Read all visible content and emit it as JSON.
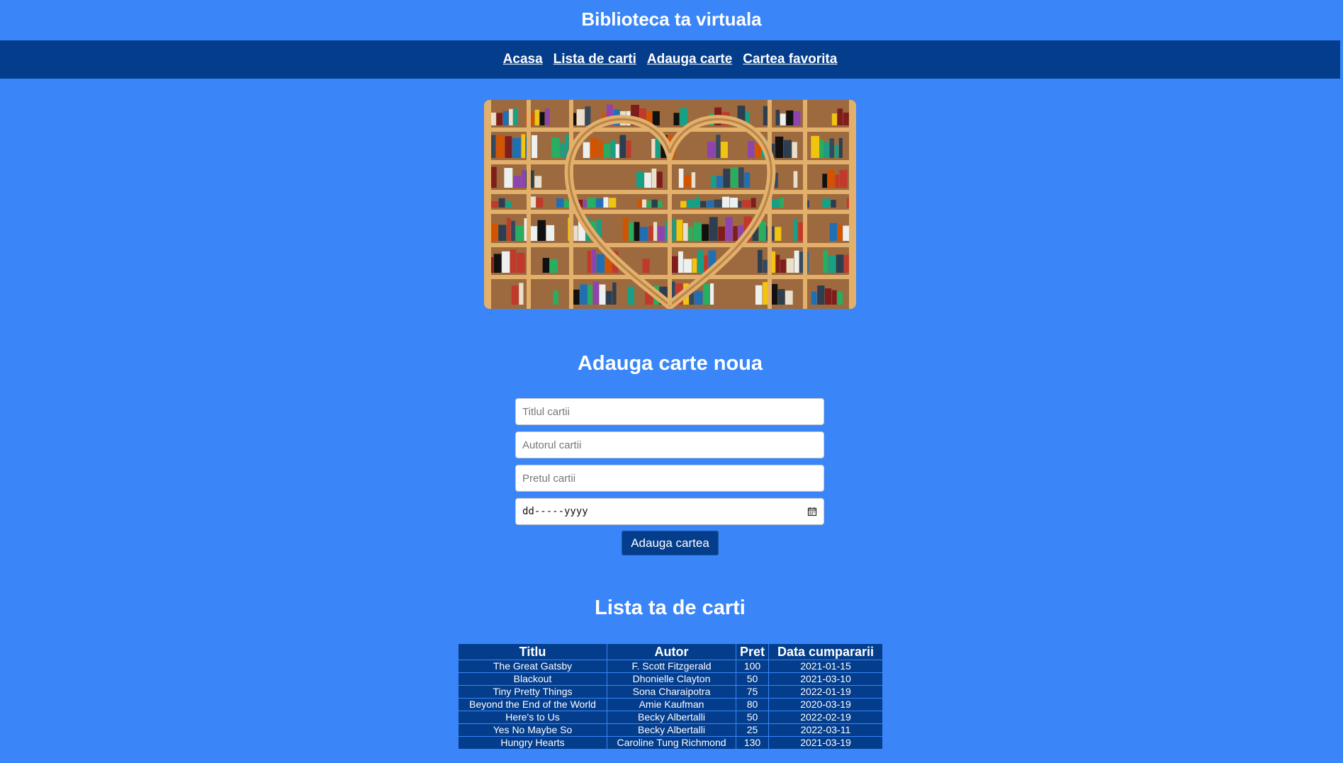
{
  "header": {
    "title": "Biblioteca ta virtuala"
  },
  "nav": {
    "items": [
      {
        "label": "Acasa"
      },
      {
        "label": "Lista de carti"
      },
      {
        "label": "Adauga carte"
      },
      {
        "label": "Cartea favorita"
      }
    ]
  },
  "form": {
    "title": "Adauga carte noua",
    "title_placeholder": "Titlul cartii",
    "author_placeholder": "Autorul cartii",
    "price_placeholder": "Pretul cartii",
    "date_placeholder": "dd-----yyyy",
    "submit_label": "Adauga cartea"
  },
  "books": {
    "title": "Lista ta de carti",
    "columns": [
      "Titlu",
      "Autor",
      "Pret",
      "Data cumpararii"
    ],
    "rows": [
      [
        "The Great Gatsby",
        "F. Scott Fitzgerald",
        "100",
        "2021-01-15"
      ],
      [
        "Blackout",
        "Dhonielle Clayton",
        "50",
        "2021-03-10"
      ],
      [
        "Tiny Pretty Things",
        "Sona Charaipotra",
        "75",
        "2022-01-19"
      ],
      [
        "Beyond the End of the World",
        "Amie Kaufman",
        "80",
        "2020-03-19"
      ],
      [
        "Here's to Us",
        "Becky Albertalli",
        "50",
        "2022-02-19"
      ],
      [
        "Yes No Maybe So",
        "Becky Albertalli",
        "25",
        "2022-03-11"
      ],
      [
        "Hungry Hearts",
        "Caroline Tung Richmond",
        "130",
        "2021-03-19"
      ]
    ]
  },
  "colors": {
    "page_background": "#3a86f8",
    "navbar_background": "#033d8c",
    "button_background": "#033d8c",
    "table_background": "#033d8c"
  },
  "icons": {
    "date_picker": "calendar-icon"
  }
}
